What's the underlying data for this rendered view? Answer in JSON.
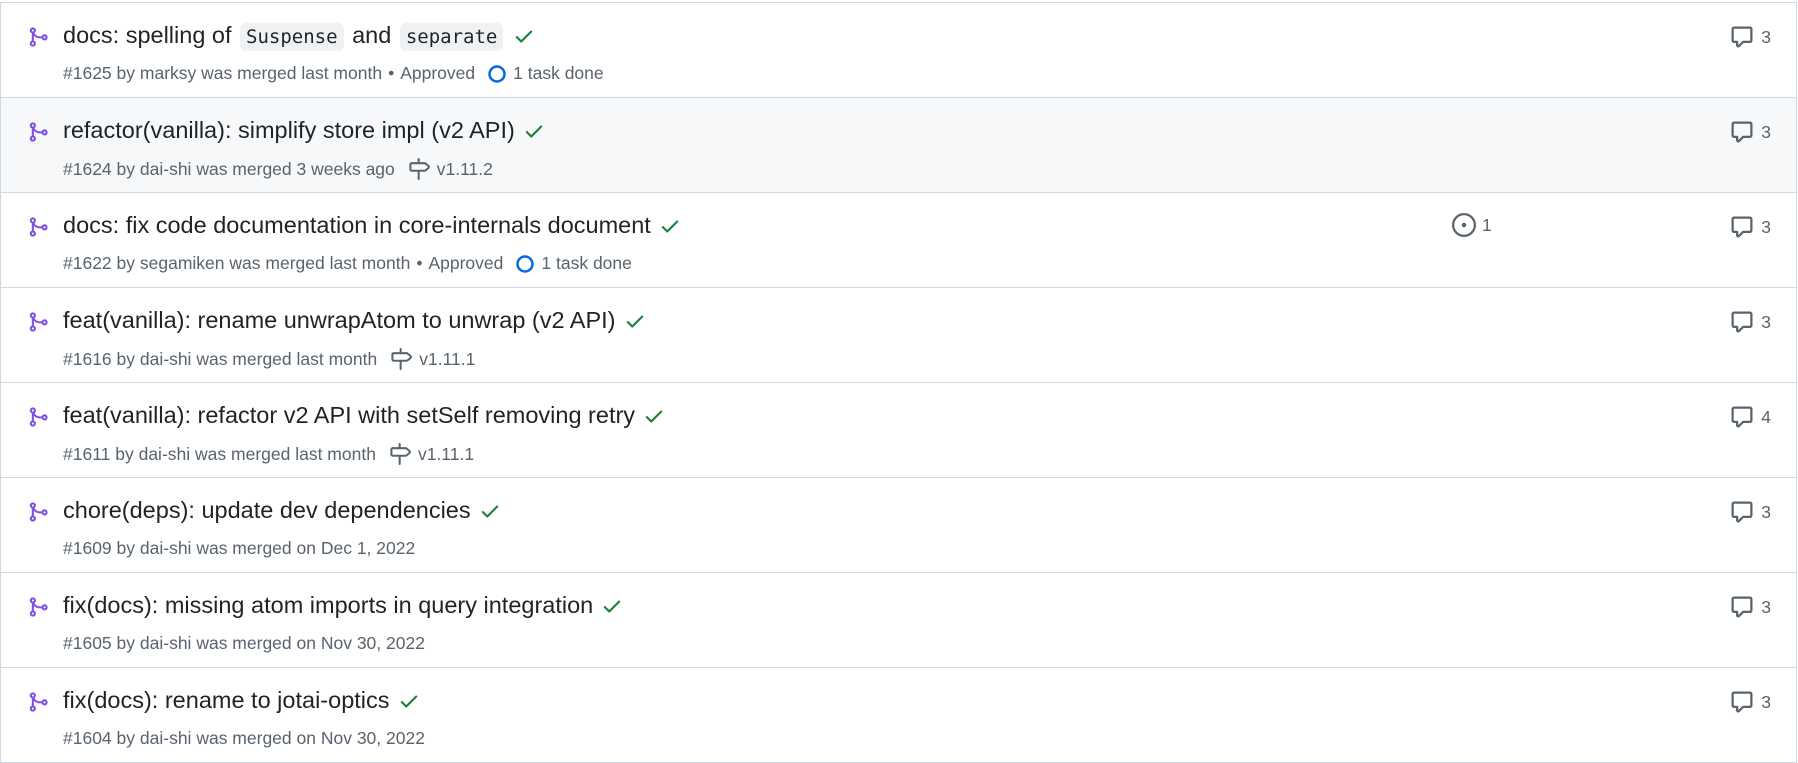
{
  "colors": {
    "merged": "#8250df",
    "success": "#1a7f37",
    "muted": "#59636e",
    "task_blue": "#0969da",
    "border": "#d0d7de",
    "hover_bg": "#f6f8fa"
  },
  "icons": {
    "merged": "git-merge-icon",
    "check": "check-icon",
    "comment": "comment-icon",
    "milestone": "milestone-icon",
    "task": "task-progress-icon",
    "issue": "linked-issue-icon"
  },
  "pull_requests": [
    {
      "title_parts": [
        "docs: spelling of ",
        "Suspense",
        " and ",
        "separate"
      ],
      "number": "#1625",
      "author": "marksy",
      "merged_text": "was merged last month",
      "review": "Approved",
      "tasks": "1 task done",
      "milestone": "",
      "comments": "3"
    },
    {
      "title": "refactor(vanilla): simplify store impl (v2 API)",
      "number": "#1624",
      "author": "dai-shi",
      "merged_text": "was merged 3 weeks ago",
      "milestone": "v1.11.2",
      "comments": "3"
    },
    {
      "title": "docs: fix code documentation in core-internals document",
      "number": "#1622",
      "author": "segamiken",
      "merged_text": "was merged last month",
      "review": "Approved",
      "tasks": "1 task done",
      "linked_issues": "1",
      "comments": "3"
    },
    {
      "title": "feat(vanilla): rename unwrapAtom to unwrap (v2 API)",
      "number": "#1616",
      "author": "dai-shi",
      "merged_text": "was merged last month",
      "milestone": "v1.11.1",
      "comments": "3"
    },
    {
      "title": "feat(vanilla): refactor v2 API with setSelf removing retry",
      "number": "#1611",
      "author": "dai-shi",
      "merged_text": "was merged last month",
      "milestone": "v1.11.1",
      "comments": "4"
    },
    {
      "title": "chore(deps): update dev dependencies",
      "number": "#1609",
      "author": "dai-shi",
      "merged_text": "was merged on Dec 1, 2022",
      "comments": "3"
    },
    {
      "title": "fix(docs): missing atom imports in query integration",
      "number": "#1605",
      "author": "dai-shi",
      "merged_text": "was merged on Nov 30, 2022",
      "comments": "3"
    },
    {
      "title": "fix(docs): rename to jotai-optics",
      "number": "#1604",
      "author": "dai-shi",
      "merged_text": "was merged on Nov 30, 2022",
      "comments": "3"
    }
  ]
}
